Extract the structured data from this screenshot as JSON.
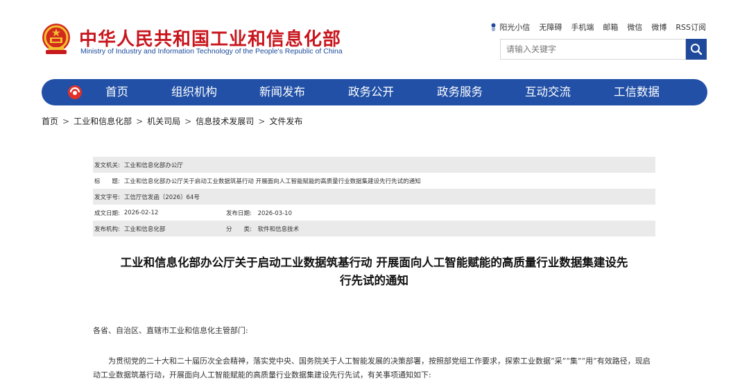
{
  "header": {
    "title_cn": "中华人民共和国工业和信息化部",
    "title_en": "Ministry of Industry and Information Technology of the People's Republic of China",
    "logo_icon": "national-emblem-icon",
    "top_links": [
      "阳光小信",
      "无障碍",
      "手机端",
      "邮箱",
      "微信",
      "微博",
      "RSS订阅"
    ],
    "search_placeholder": "请输入关键字",
    "brand_red": "#c8161d",
    "brand_blue": "#2150a6"
  },
  "nav": {
    "logo_icon": "miit-logo-icon",
    "items": [
      "首页",
      "组织机构",
      "新闻发布",
      "政务公开",
      "政务服务",
      "互动交流",
      "工信数据"
    ]
  },
  "breadcrumb": [
    "首页",
    "工业和信息化部",
    "机关司局",
    "信息技术发展司",
    "文件发布"
  ],
  "meta": {
    "issuer_label": "发文机关:",
    "issuer": "工业和信息化部办公厅",
    "title_label": "标　　题:",
    "title": "工业和信息化部办公厅关于启动工业数据筑基行动 开展面向人工智能赋能的高质量行业数据集建设先行先试的通知",
    "docno_label": "发文字号:",
    "docno": "工信厅信发函〔2026〕64号",
    "written_label": "成文日期:",
    "written": "2026-02-12",
    "published_label": "发布日期:",
    "published": "2026-03-10",
    "agency_label": "发布机构:",
    "agency": "工业和信息化部",
    "category_label": "分　　类:",
    "category": "软件和信息技术"
  },
  "document": {
    "title_line1": "工业和信息化部办公厅关于启动工业数据筑基行动 开展面向人工智能赋能的高质量行业数据集建设先",
    "title_line2": "行先试的通知",
    "salutation": "各省、自治区、直辖市工业和信息化主管部门:",
    "para1": "　　为贯彻党的二十大和二十届历次全会精神，落实党中央、国务院关于人工智能发展的决策部署，按照部党组工作要求，探索工业数据“采”“集”“用”有效路径，现启动工业数据筑基行动，开展面向人工智能赋能的高质量行业数据集建设先行先试，有关事项通知如下:"
  }
}
